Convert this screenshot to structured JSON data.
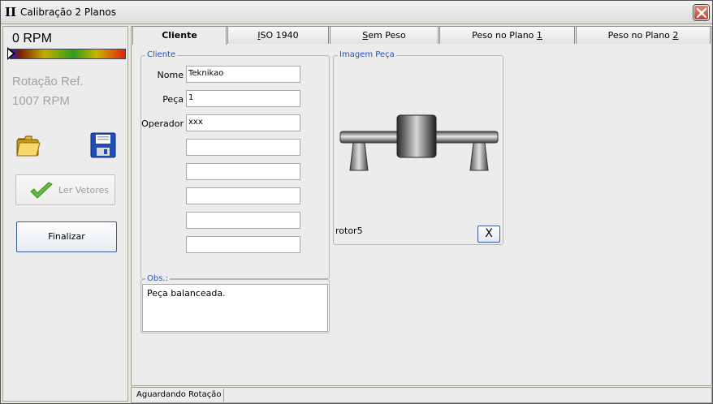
{
  "window": {
    "title": "Calibração 2 Planos",
    "icon_glyph": "II"
  },
  "left": {
    "rpm": "0 RPM",
    "ref_label": "Rotação Ref.",
    "ref_value": "1007 RPM",
    "read_button": "Ler Vetores",
    "finalize_button": "Finalizar"
  },
  "tabs": [
    {
      "label": "Cliente"
    },
    {
      "label_pre": "",
      "label_ul": "I",
      "label_post": "SO 1940"
    },
    {
      "label_pre": "",
      "label_ul": "S",
      "label_post": "em Peso"
    },
    {
      "label_pre": "Peso no Plano ",
      "label_ul": "1",
      "label_post": ""
    },
    {
      "label_pre": "Peso no Plano ",
      "label_ul": "2",
      "label_post": ""
    }
  ],
  "client": {
    "group_title": "Cliente",
    "name_label": "Nome",
    "name_value": "Teknikao",
    "piece_label": "Peça",
    "piece_value": "1",
    "operator_label": "Operador",
    "operator_value": "xxx",
    "extra_fields": [
      "",
      "",
      "",
      "",
      ""
    ]
  },
  "image": {
    "group_title": "Imagem Peça",
    "caption": "rotor5",
    "clear_button": "X"
  },
  "obs": {
    "group_title": "Obs.:",
    "text": "Peça balanceada."
  },
  "status": {
    "text": "Aguardando Rotação"
  }
}
